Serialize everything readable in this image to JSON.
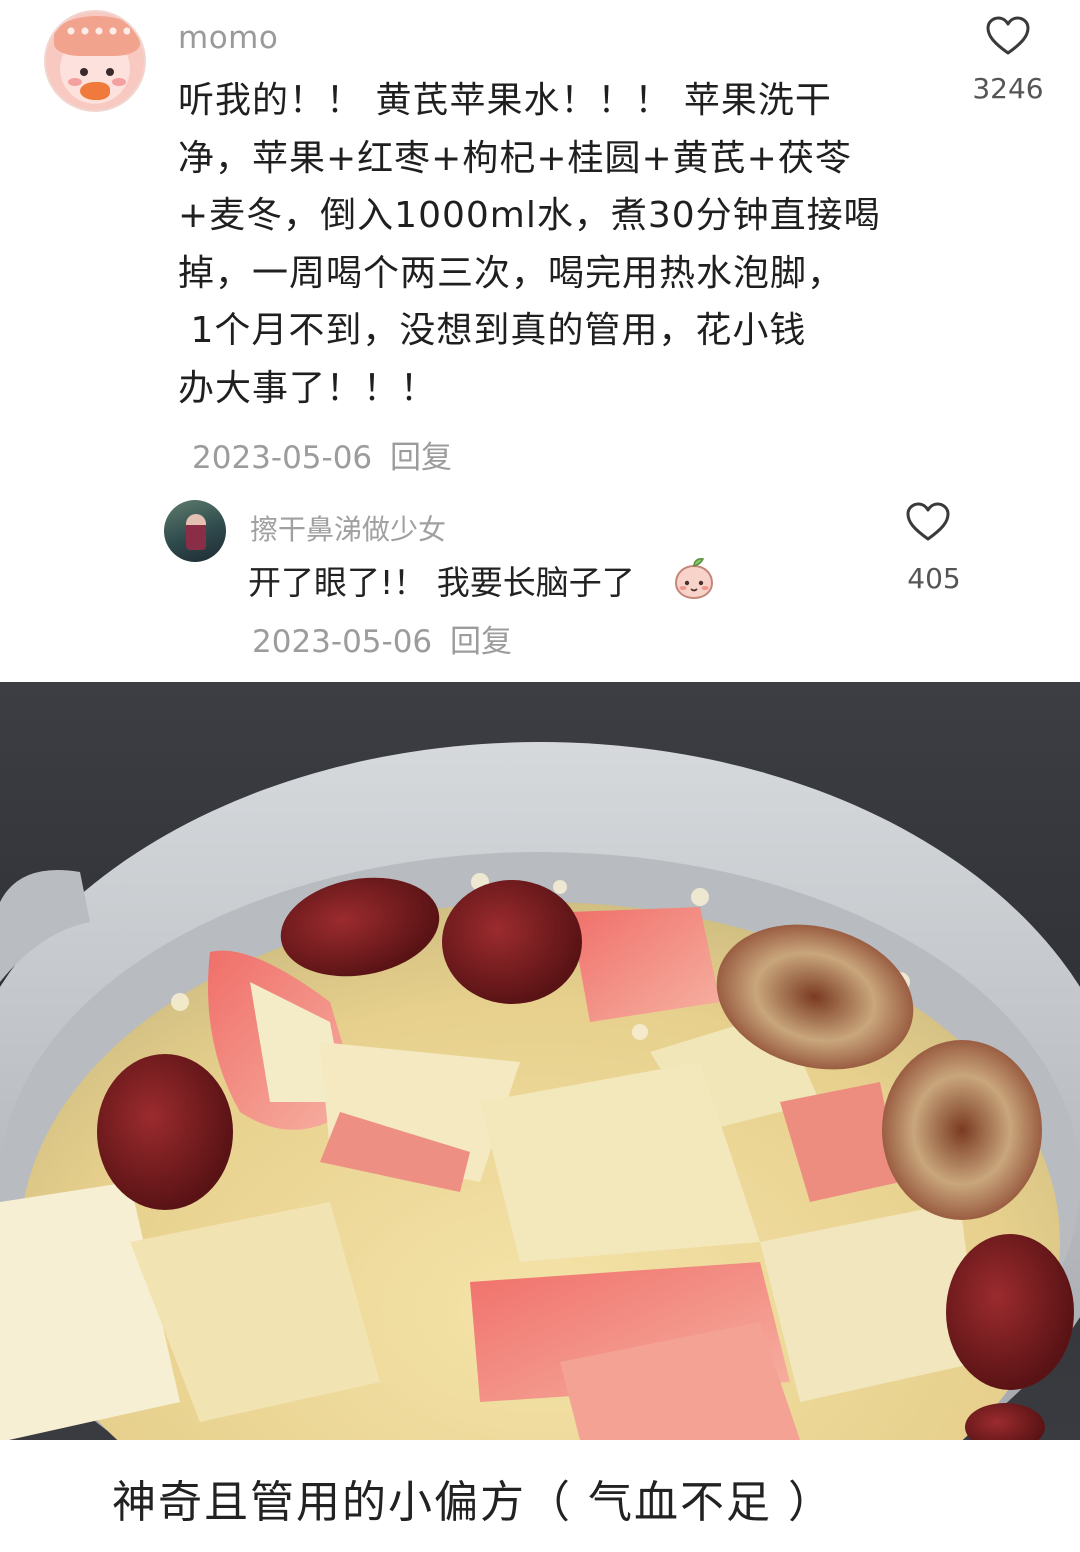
{
  "comment": {
    "username": "momo",
    "text": "听我的！！ 黄芪苹果水！！！ 苹果洗干\n净，苹果+红枣+枸杞+桂圆+黄芪+茯苓\n+麦冬，倒入1000ml水，煮30分钟直接喝\n掉，一周喝个两三次，喝完用热水泡脚，\n 1个月不到，没想到真的管用，花小钱\n办大事了！！！",
    "date": "2023-05-06",
    "reply_label": "回复",
    "like_count": "3246",
    "icons": {
      "avatar": "cartoon-avatar-icon",
      "like": "heart-icon"
    }
  },
  "reply": {
    "username": "擦干鼻涕做少女",
    "text": "开了眼了!！ 我要长脑子了",
    "emoji": "peach-face-emoji-icon",
    "date": "2023-05-06",
    "reply_label": "回复",
    "like_count": "405",
    "icons": {
      "avatar": "user-photo-avatar",
      "like": "heart-icon"
    }
  },
  "caption": "神奇且管用的小偏方（ 气血不足 ）",
  "colors": {
    "text_primary": "#1f1f1f",
    "text_meta": "#9c9c9c",
    "username": "#9a9a9a",
    "background": "#ffffff"
  }
}
